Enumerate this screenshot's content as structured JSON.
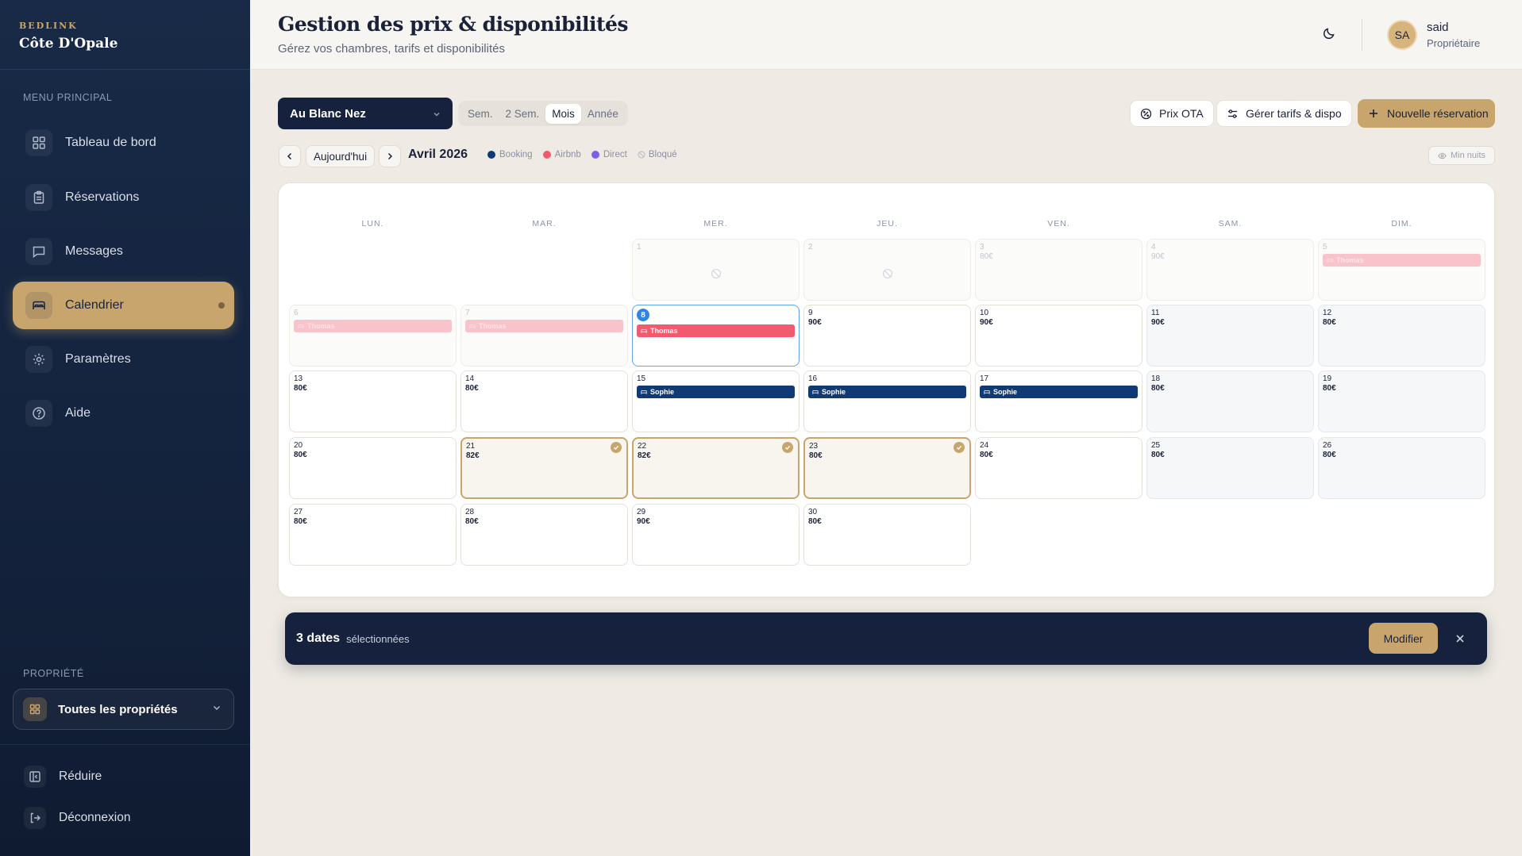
{
  "sidebar": {
    "brand_small": "BEDLINK",
    "brand_name": "Côte D'Opale",
    "menu_title": "MENU PRINCIPAL",
    "items": [
      {
        "label": "Tableau de bord",
        "icon": "dashboard-icon"
      },
      {
        "label": "Réservations",
        "icon": "clipboard-icon"
      },
      {
        "label": "Messages",
        "icon": "message-icon"
      },
      {
        "label": "Calendrier",
        "icon": "bed-icon",
        "active": true
      },
      {
        "label": "Paramètres",
        "icon": "gear-icon"
      },
      {
        "label": "Aide",
        "icon": "help-icon"
      }
    ],
    "property_title": "PROPRIÉTÉ",
    "property_select": "Toutes les propriétés",
    "reduce_label": "Réduire",
    "logout_label": "Déconnexion"
  },
  "header": {
    "title": "Gestion des prix & disponibilités",
    "subtitle": "Gérez vos chambres, tarifs et disponibilités",
    "user_initials": "SA",
    "user_name": "said",
    "user_role": "Propriétaire"
  },
  "toolbar": {
    "room_select": "Au Blanc Nez",
    "view_tabs": [
      {
        "label": "Sem.",
        "active": false
      },
      {
        "label": "2 Sem.",
        "active": false
      },
      {
        "label": "Mois",
        "active": true
      },
      {
        "label": "Année",
        "active": false
      }
    ],
    "prix_ota": "Prix OTA",
    "manage_rates": "Gérer tarifs & dispo",
    "new_reservation": "Nouvelle réservation",
    "today": "Aujourd'hui",
    "month_label": "Avril 2026",
    "legend": [
      {
        "label": "Booking",
        "color": "#0f3a75"
      },
      {
        "label": "Airbnb",
        "color": "#f25a6e"
      },
      {
        "label": "Direct",
        "color": "#7b61e8"
      },
      {
        "label": "Bloqué",
        "color": "#b6bac4"
      }
    ],
    "min_nights": "Min nuits"
  },
  "calendar": {
    "weekdays": [
      "LUN.",
      "MAR.",
      "MER.",
      "JEU.",
      "VEN.",
      "SAM.",
      "DIM."
    ],
    "days": [
      {
        "day": "1",
        "price": "",
        "state": "past",
        "blocked": true
      },
      {
        "day": "2",
        "price": "",
        "state": "past",
        "blocked": true
      },
      {
        "day": "3",
        "price": "80€",
        "state": "past"
      },
      {
        "day": "4",
        "price": "90€",
        "state": "past"
      },
      {
        "day": "5",
        "price": "",
        "state": "past",
        "booking": {
          "guest": "Thomas",
          "channel": "airbnb-past"
        }
      },
      {
        "day": "6",
        "price": "",
        "state": "past",
        "booking": {
          "guest": "Thomas",
          "channel": "airbnb-past"
        }
      },
      {
        "day": "7",
        "price": "",
        "state": "past",
        "booking": {
          "guest": "Thomas",
          "channel": "airbnb-past"
        }
      },
      {
        "day": "8",
        "price": "",
        "state": "today",
        "booking": {
          "guest": "Thomas",
          "channel": "airbnb"
        }
      },
      {
        "day": "9",
        "price": "90€",
        "state": "normal"
      },
      {
        "day": "10",
        "price": "90€",
        "state": "normal"
      },
      {
        "day": "11",
        "price": "90€",
        "state": "weekend"
      },
      {
        "day": "12",
        "price": "80€",
        "state": "weekend"
      },
      {
        "day": "13",
        "price": "80€",
        "state": "normal"
      },
      {
        "day": "14",
        "price": "80€",
        "state": "normal"
      },
      {
        "day": "15",
        "price": "",
        "state": "normal",
        "booking": {
          "guest": "Sophie",
          "channel": "booking"
        }
      },
      {
        "day": "16",
        "price": "",
        "state": "normal",
        "booking": {
          "guest": "Sophie",
          "channel": "booking"
        }
      },
      {
        "day": "17",
        "price": "",
        "state": "normal",
        "booking": {
          "guest": "Sophie",
          "channel": "booking"
        }
      },
      {
        "day": "18",
        "price": "80€",
        "state": "weekend"
      },
      {
        "day": "19",
        "price": "80€",
        "state": "weekend"
      },
      {
        "day": "20",
        "price": "80€",
        "state": "normal"
      },
      {
        "day": "21",
        "price": "82€",
        "state": "selected"
      },
      {
        "day": "22",
        "price": "82€",
        "state": "selected"
      },
      {
        "day": "23",
        "price": "80€",
        "state": "selected"
      },
      {
        "day": "24",
        "price": "80€",
        "state": "normal"
      },
      {
        "day": "25",
        "price": "80€",
        "state": "weekend"
      },
      {
        "day": "26",
        "price": "80€",
        "state": "weekend"
      },
      {
        "day": "27",
        "price": "80€",
        "state": "normal"
      },
      {
        "day": "28",
        "price": "80€",
        "state": "normal"
      },
      {
        "day": "29",
        "price": "90€",
        "state": "normal"
      },
      {
        "day": "30",
        "price": "80€",
        "state": "normal"
      }
    ]
  },
  "selection": {
    "count": "3 dates",
    "text": "sélectionnées",
    "modify": "Modifier"
  }
}
